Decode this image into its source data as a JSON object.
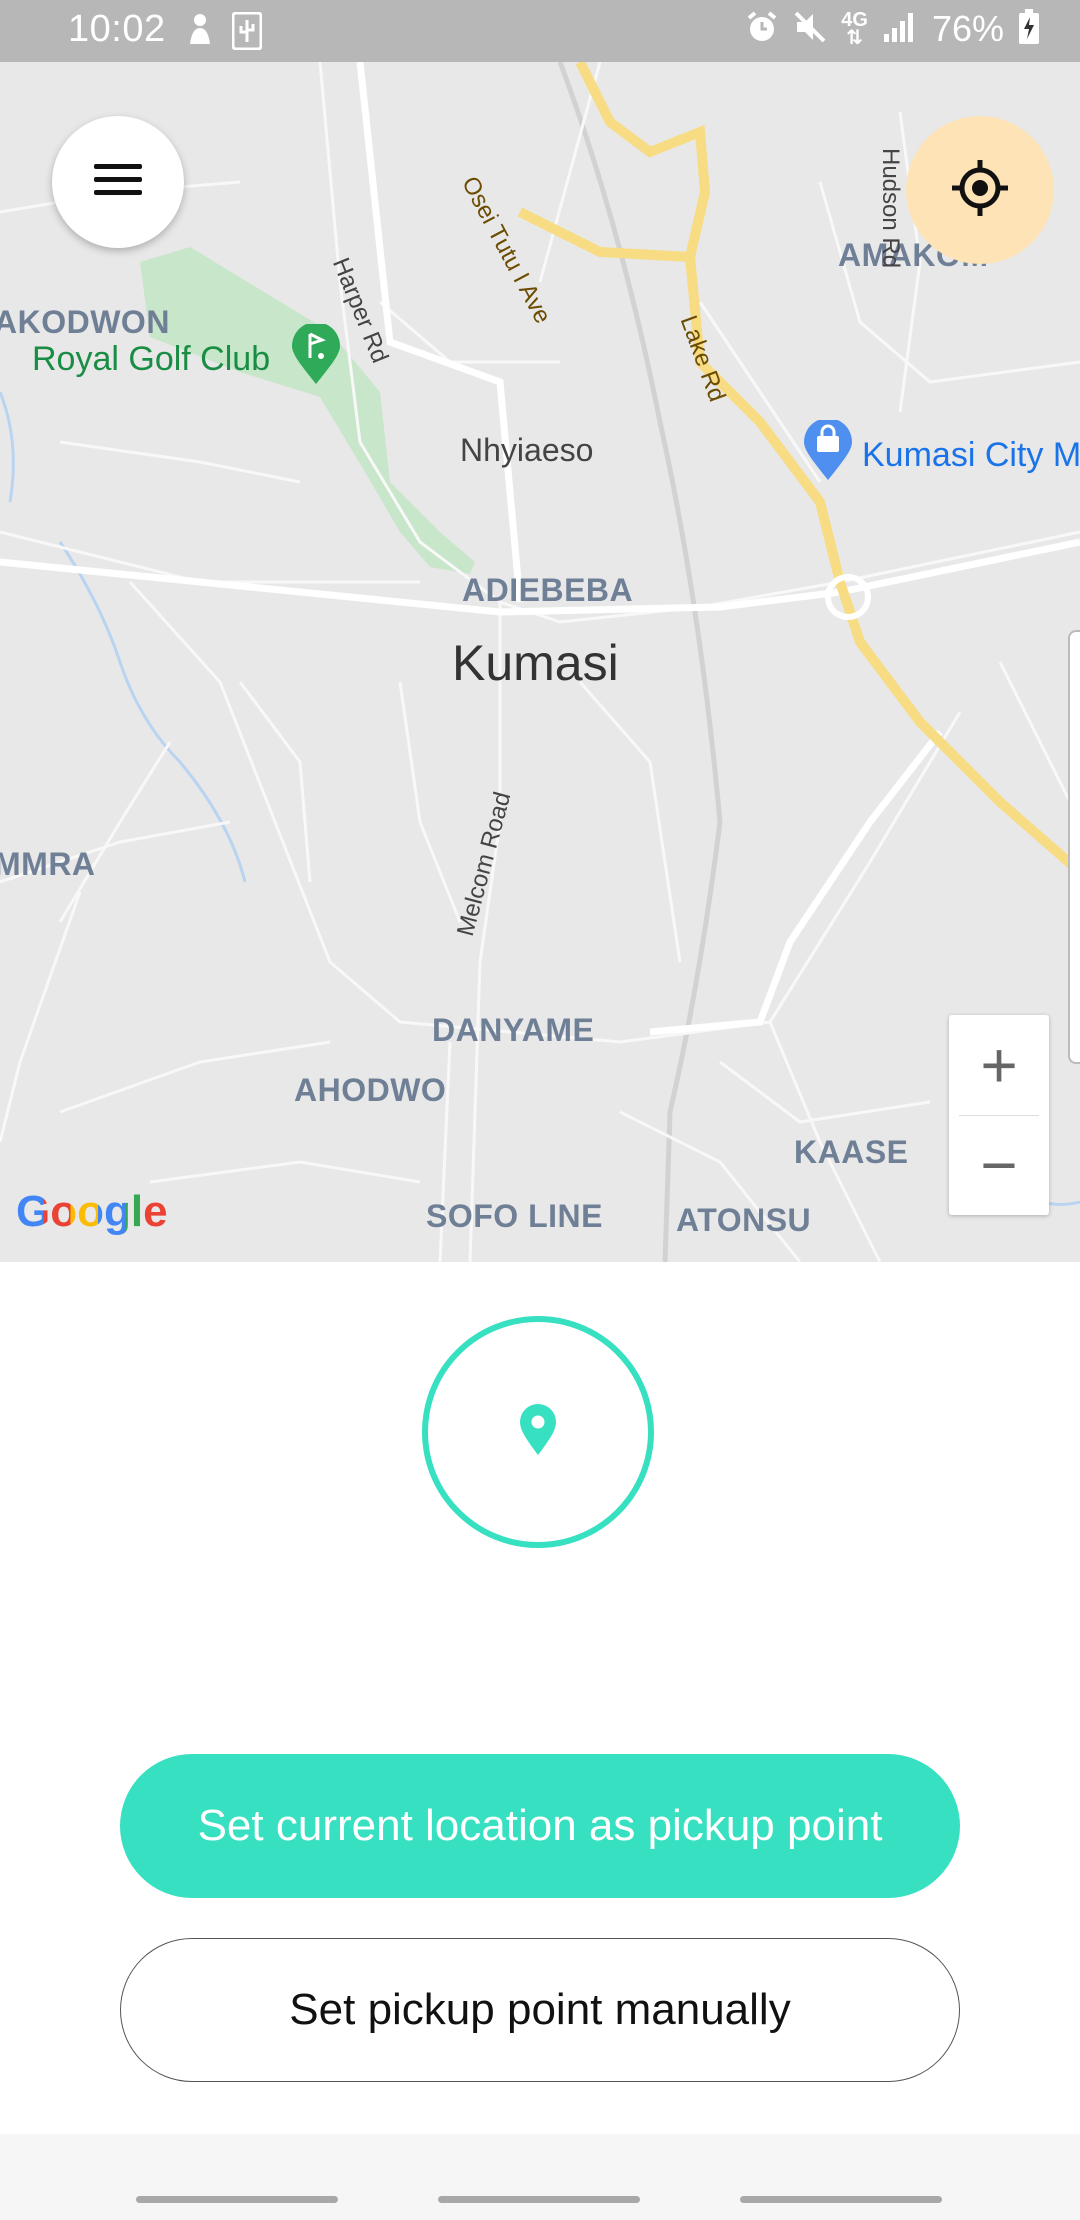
{
  "status_bar": {
    "time": "10:02",
    "battery_percent": "76%",
    "network": "4G",
    "icons": [
      "notification-icon",
      "usb-icon",
      "alarm-icon",
      "mute-icon",
      "network-4g-icon",
      "signal-icon",
      "battery-charging-icon"
    ]
  },
  "map": {
    "city": "Kumasi",
    "areas": [
      "AKODWON",
      "AMAKOM",
      "ADIEBEBA",
      "MMRA",
      "DANYAME",
      "AHODWO",
      "KAASE",
      "SOFO LINE",
      "ATONSU"
    ],
    "places": [
      "Nhyiaeso"
    ],
    "poi_golf": "Royal Golf Club",
    "poi_shop": "Kumasi City M",
    "roads": [
      "Osei Tutu I Ave",
      "Harper Rd",
      "Lake Rd",
      "Melcom Road",
      "Hudson Rd"
    ],
    "attribution": "Google",
    "zoom_in": "+",
    "zoom_out": "−"
  },
  "actions": {
    "primary": "Set current location as pickup point",
    "secondary": "Set pickup point manually"
  },
  "colors": {
    "accent": "#36e0c0",
    "locate_button": "#fde3b6",
    "status_bar": "#b7b7b7"
  }
}
